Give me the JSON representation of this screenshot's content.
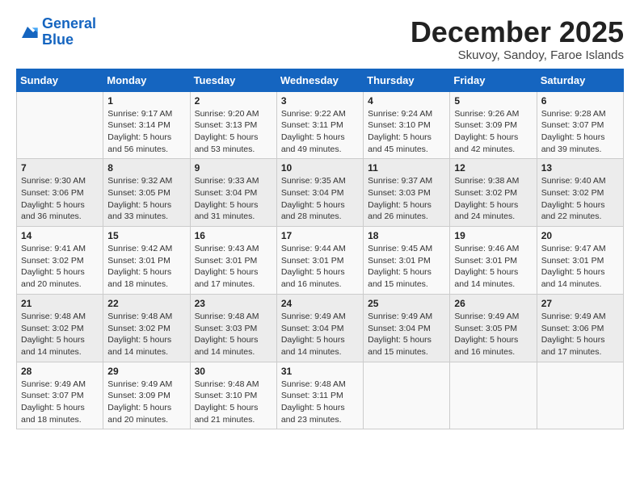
{
  "header": {
    "logo_line1": "General",
    "logo_line2": "Blue",
    "month_title": "December 2025",
    "subtitle": "Skuvoy, Sandoy, Faroe Islands"
  },
  "weekdays": [
    "Sunday",
    "Monday",
    "Tuesday",
    "Wednesday",
    "Thursday",
    "Friday",
    "Saturday"
  ],
  "weeks": [
    [
      {
        "day": "",
        "info": ""
      },
      {
        "day": "1",
        "info": "Sunrise: 9:17 AM\nSunset: 3:14 PM\nDaylight: 5 hours\nand 56 minutes."
      },
      {
        "day": "2",
        "info": "Sunrise: 9:20 AM\nSunset: 3:13 PM\nDaylight: 5 hours\nand 53 minutes."
      },
      {
        "day": "3",
        "info": "Sunrise: 9:22 AM\nSunset: 3:11 PM\nDaylight: 5 hours\nand 49 minutes."
      },
      {
        "day": "4",
        "info": "Sunrise: 9:24 AM\nSunset: 3:10 PM\nDaylight: 5 hours\nand 45 minutes."
      },
      {
        "day": "5",
        "info": "Sunrise: 9:26 AM\nSunset: 3:09 PM\nDaylight: 5 hours\nand 42 minutes."
      },
      {
        "day": "6",
        "info": "Sunrise: 9:28 AM\nSunset: 3:07 PM\nDaylight: 5 hours\nand 39 minutes."
      }
    ],
    [
      {
        "day": "7",
        "info": "Sunrise: 9:30 AM\nSunset: 3:06 PM\nDaylight: 5 hours\nand 36 minutes."
      },
      {
        "day": "8",
        "info": "Sunrise: 9:32 AM\nSunset: 3:05 PM\nDaylight: 5 hours\nand 33 minutes."
      },
      {
        "day": "9",
        "info": "Sunrise: 9:33 AM\nSunset: 3:04 PM\nDaylight: 5 hours\nand 31 minutes."
      },
      {
        "day": "10",
        "info": "Sunrise: 9:35 AM\nSunset: 3:04 PM\nDaylight: 5 hours\nand 28 minutes."
      },
      {
        "day": "11",
        "info": "Sunrise: 9:37 AM\nSunset: 3:03 PM\nDaylight: 5 hours\nand 26 minutes."
      },
      {
        "day": "12",
        "info": "Sunrise: 9:38 AM\nSunset: 3:02 PM\nDaylight: 5 hours\nand 24 minutes."
      },
      {
        "day": "13",
        "info": "Sunrise: 9:40 AM\nSunset: 3:02 PM\nDaylight: 5 hours\nand 22 minutes."
      }
    ],
    [
      {
        "day": "14",
        "info": "Sunrise: 9:41 AM\nSunset: 3:02 PM\nDaylight: 5 hours\nand 20 minutes."
      },
      {
        "day": "15",
        "info": "Sunrise: 9:42 AM\nSunset: 3:01 PM\nDaylight: 5 hours\nand 18 minutes."
      },
      {
        "day": "16",
        "info": "Sunrise: 9:43 AM\nSunset: 3:01 PM\nDaylight: 5 hours\nand 17 minutes."
      },
      {
        "day": "17",
        "info": "Sunrise: 9:44 AM\nSunset: 3:01 PM\nDaylight: 5 hours\nand 16 minutes."
      },
      {
        "day": "18",
        "info": "Sunrise: 9:45 AM\nSunset: 3:01 PM\nDaylight: 5 hours\nand 15 minutes."
      },
      {
        "day": "19",
        "info": "Sunrise: 9:46 AM\nSunset: 3:01 PM\nDaylight: 5 hours\nand 14 minutes."
      },
      {
        "day": "20",
        "info": "Sunrise: 9:47 AM\nSunset: 3:01 PM\nDaylight: 5 hours\nand 14 minutes."
      }
    ],
    [
      {
        "day": "21",
        "info": "Sunrise: 9:48 AM\nSunset: 3:02 PM\nDaylight: 5 hours\nand 14 minutes."
      },
      {
        "day": "22",
        "info": "Sunrise: 9:48 AM\nSunset: 3:02 PM\nDaylight: 5 hours\nand 14 minutes."
      },
      {
        "day": "23",
        "info": "Sunrise: 9:48 AM\nSunset: 3:03 PM\nDaylight: 5 hours\nand 14 minutes."
      },
      {
        "day": "24",
        "info": "Sunrise: 9:49 AM\nSunset: 3:04 PM\nDaylight: 5 hours\nand 14 minutes."
      },
      {
        "day": "25",
        "info": "Sunrise: 9:49 AM\nSunset: 3:04 PM\nDaylight: 5 hours\nand 15 minutes."
      },
      {
        "day": "26",
        "info": "Sunrise: 9:49 AM\nSunset: 3:05 PM\nDaylight: 5 hours\nand 16 minutes."
      },
      {
        "day": "27",
        "info": "Sunrise: 9:49 AM\nSunset: 3:06 PM\nDaylight: 5 hours\nand 17 minutes."
      }
    ],
    [
      {
        "day": "28",
        "info": "Sunrise: 9:49 AM\nSunset: 3:07 PM\nDaylight: 5 hours\nand 18 minutes."
      },
      {
        "day": "29",
        "info": "Sunrise: 9:49 AM\nSunset: 3:09 PM\nDaylight: 5 hours\nand 20 minutes."
      },
      {
        "day": "30",
        "info": "Sunrise: 9:48 AM\nSunset: 3:10 PM\nDaylight: 5 hours\nand 21 minutes."
      },
      {
        "day": "31",
        "info": "Sunrise: 9:48 AM\nSunset: 3:11 PM\nDaylight: 5 hours\nand 23 minutes."
      },
      {
        "day": "",
        "info": ""
      },
      {
        "day": "",
        "info": ""
      },
      {
        "day": "",
        "info": ""
      }
    ]
  ]
}
